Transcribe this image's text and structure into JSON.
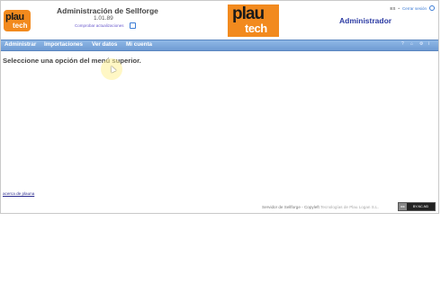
{
  "header": {
    "small_logo": {
      "line1": "plau",
      "line2": "tech"
    },
    "app_title": "Administración de Sellforge",
    "version": "1.01.89",
    "update_link": "Comprobar actualizaciones",
    "big_logo": {
      "line1": "plau",
      "line2": "tech"
    },
    "user": "Administrador",
    "top_right": {
      "lang": "ES",
      "logout": "Cerrar sesión"
    }
  },
  "menu": {
    "items": [
      "Administrar",
      "Importaciones",
      "Ver datos",
      "Mi cuenta"
    ]
  },
  "main": {
    "message": "Seleccione una opción del menú superior."
  },
  "footer": {
    "about_link": "acerca de plauna",
    "copyright_prefix": "Servidor de Sellforge - Copyleft",
    "copyright_company": "Tecnologías de Plau Logan S.L.",
    "cc_badge": {
      "left": "cc",
      "right": "BY-NC-ND"
    }
  },
  "colors": {
    "brand_orange": "#f28a1e",
    "menu_blue": "#6e9bd3",
    "user_blue": "#2b3aa3"
  }
}
